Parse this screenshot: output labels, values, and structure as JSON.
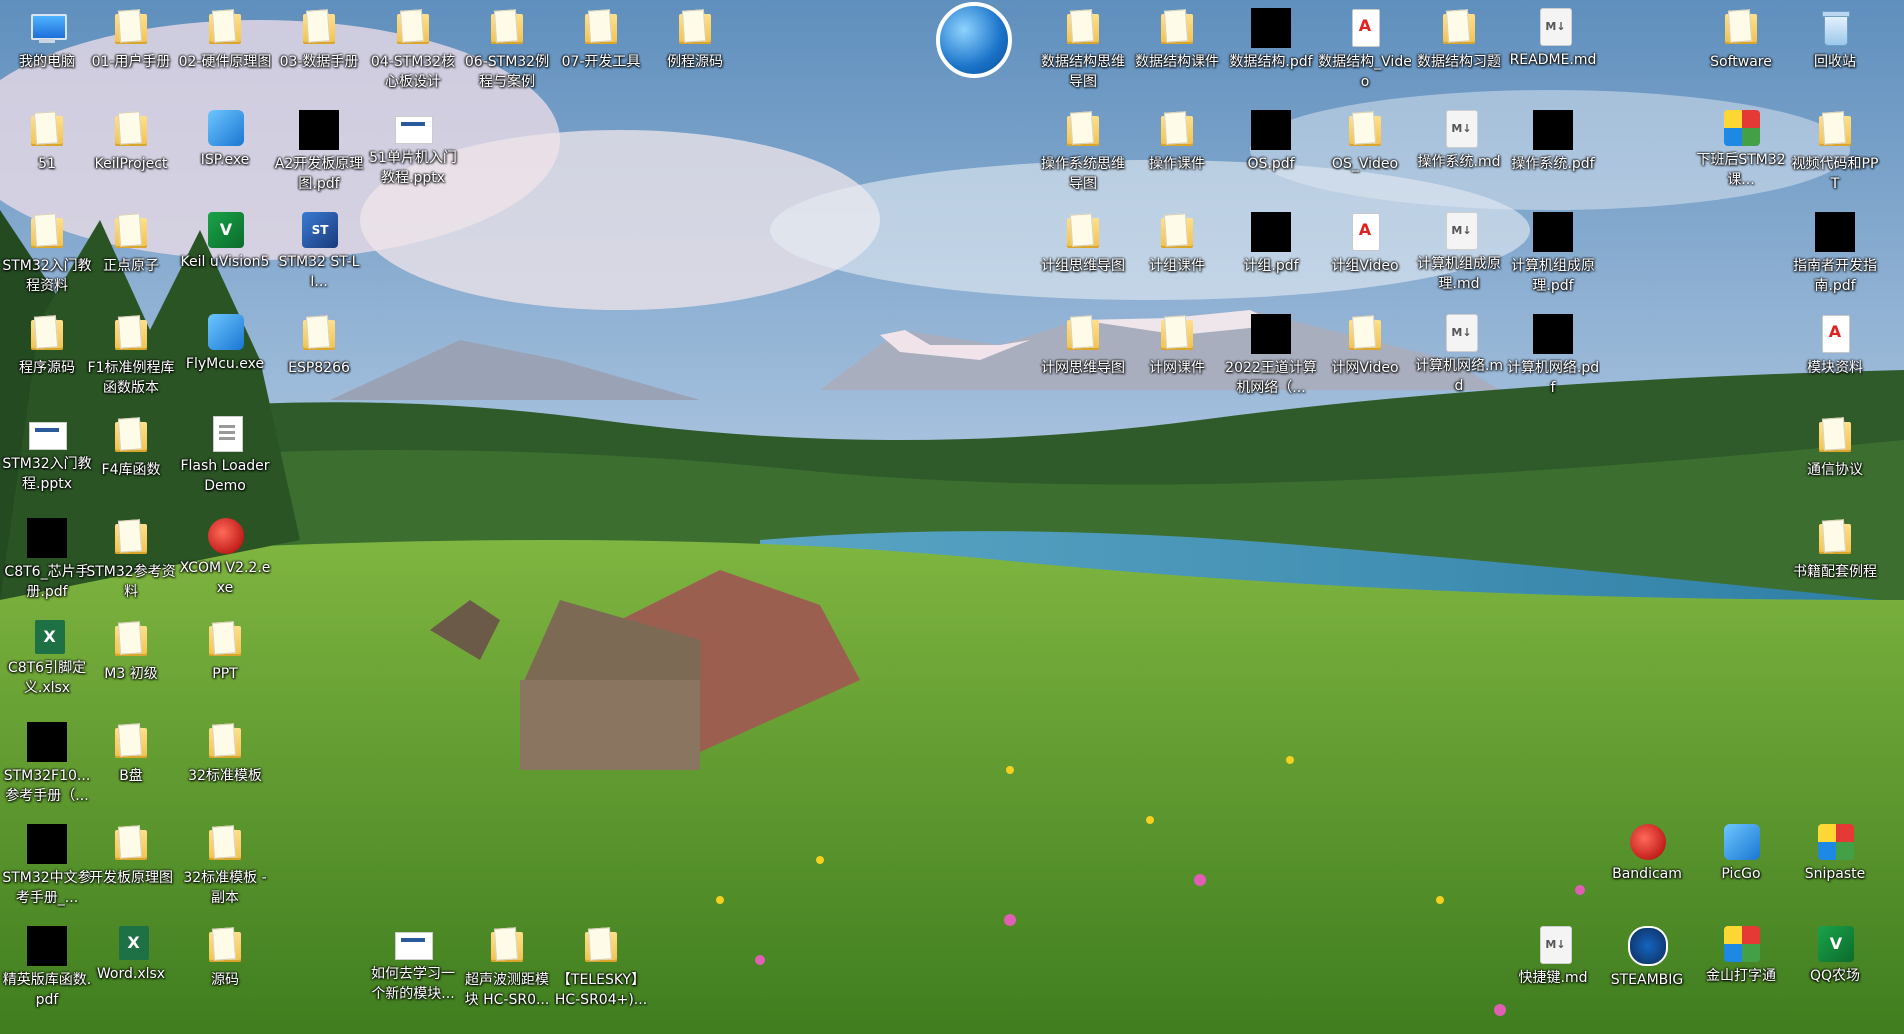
{
  "desktop": {
    "icons": [
      {
        "id": "c1r1",
        "label": "我的电脑",
        "icon": "computer-icon",
        "type": "computer"
      },
      {
        "id": "c2r1",
        "label": "01-用户手册",
        "icon": "folder-icon",
        "type": "folder"
      },
      {
        "id": "c3r1",
        "label": "02-硬件原理图",
        "icon": "folder-icon",
        "type": "folder"
      },
      {
        "id": "c4r1",
        "label": "03-数据手册",
        "icon": "folder-icon",
        "type": "folder"
      },
      {
        "id": "c5r1",
        "label": "04-STM32核心板设计",
        "icon": "folder-icon",
        "type": "folder"
      },
      {
        "id": "c6r1",
        "label": "06-STM32例程与案例",
        "icon": "folder-icon",
        "type": "folder"
      },
      {
        "id": "c7r1",
        "label": "07-开发工具",
        "icon": "folder-icon",
        "type": "folder"
      },
      {
        "id": "c8r1",
        "label": "例程源码",
        "icon": "folder-icon",
        "type": "folder"
      },
      {
        "id": "c1r2",
        "label": "51",
        "icon": "folder-icon",
        "type": "folder"
      },
      {
        "id": "c2r2",
        "label": "KeilProject",
        "icon": "folder-icon",
        "type": "folder"
      },
      {
        "id": "c3r2",
        "label": "ISP.exe",
        "icon": "isp-icon",
        "type": "app4"
      },
      {
        "id": "c4r2",
        "label": "A2开发板原理图.pdf",
        "icon": "black-thumbnail-icon",
        "type": "black"
      },
      {
        "id": "c5r2",
        "label": "51单片机入门教程.pptx",
        "icon": "pptx-icon",
        "type": "pptx"
      },
      {
        "id": "c1r3",
        "label": "STM32入门教程资料",
        "icon": "folder-icon",
        "type": "folder"
      },
      {
        "id": "c2r3",
        "label": "正点原子",
        "icon": "folder-icon",
        "type": "folder"
      },
      {
        "id": "c3r3",
        "label": "Keil uVision5",
        "icon": "keil-icon",
        "type": "app1"
      },
      {
        "id": "c4r3",
        "label": "STM32 ST-LI...",
        "icon": "stlink-icon",
        "type": "app2"
      },
      {
        "id": "c1r4",
        "label": "程序源码",
        "icon": "folder-icon",
        "type": "folder"
      },
      {
        "id": "c2r4",
        "label": "F1标准例程库函数版本",
        "icon": "folder-icon",
        "type": "folder"
      },
      {
        "id": "c3r4",
        "label": "FlyMcu.exe",
        "icon": "flymcu-icon",
        "type": "app4"
      },
      {
        "id": "c4r4",
        "label": "ESP8266",
        "icon": "folder-icon",
        "type": "folder"
      },
      {
        "id": "c1r5",
        "label": "STM32入门教程.pptx",
        "icon": "pptx-icon",
        "type": "pptx"
      },
      {
        "id": "c2r5",
        "label": "F4库函数",
        "icon": "folder-icon",
        "type": "folder"
      },
      {
        "id": "c3r5",
        "label": "Flash Loader Demo",
        "icon": "flash-loader-icon",
        "type": "doc"
      },
      {
        "id": "c1r6",
        "label": "C8T6_芯片手册.pdf",
        "icon": "black-thumbnail-icon",
        "type": "black"
      },
      {
        "id": "c2r6",
        "label": "STM32参考资料",
        "icon": "folder-icon",
        "type": "folder"
      },
      {
        "id": "c3r6",
        "label": "XCOM V2.2.exe",
        "icon": "xcom-icon",
        "type": "app3"
      },
      {
        "id": "c1r7",
        "label": "C8T6引脚定义.xlsx",
        "icon": "excel-icon",
        "type": "xlsx"
      },
      {
        "id": "c2r7",
        "label": "M3 初级",
        "icon": "folder-icon",
        "type": "folder"
      },
      {
        "id": "c3r7",
        "label": "PPT",
        "icon": "folder-icon",
        "type": "folder"
      },
      {
        "id": "c1r8",
        "label": "STM32F10...参考手册（...",
        "icon": "black-thumbnail-icon",
        "type": "black"
      },
      {
        "id": "c2r8",
        "label": "B盘",
        "icon": "folder-icon",
        "type": "folder"
      },
      {
        "id": "c3r8",
        "label": "32标准模板",
        "icon": "folder-icon",
        "type": "folder"
      },
      {
        "id": "c1r9",
        "label": "STM32中文参考手册_...",
        "icon": "black-thumbnail-icon",
        "type": "black"
      },
      {
        "id": "c2r9",
        "label": "开发板原理图",
        "icon": "folder-icon",
        "type": "folder"
      },
      {
        "id": "c3r9",
        "label": "32标准模板 - 副本",
        "icon": "folder-icon",
        "type": "folder"
      },
      {
        "id": "c1r10",
        "label": "精英版库函数.pdf",
        "icon": "black-thumbnail-icon",
        "type": "black"
      },
      {
        "id": "c2r10",
        "label": "Word.xlsx",
        "icon": "excel-icon",
        "type": "xlsx"
      },
      {
        "id": "c3r10",
        "label": "源码",
        "icon": "folder-icon",
        "type": "folder"
      },
      {
        "id": "c5r10",
        "label": "如何去学习一个新的模块...",
        "icon": "pptx-icon",
        "type": "pptx"
      },
      {
        "id": "c6r10",
        "label": "超声波测距模块 HC-SR0...",
        "icon": "folder-icon",
        "type": "folder"
      },
      {
        "id": "c7r10",
        "label": "【TELESKY】HC-SR04+)...",
        "icon": "folder-icon",
        "type": "folder"
      },
      {
        "id": "r1c11",
        "label": "数据结构思维导图",
        "icon": "folder-icon",
        "type": "folder"
      },
      {
        "id": "r1c12",
        "label": "数据结构课件",
        "icon": "folder-icon",
        "type": "folder"
      },
      {
        "id": "r1c13",
        "label": "数据结构.pdf",
        "icon": "black-thumbnail-icon",
        "type": "black"
      },
      {
        "id": "r1c14",
        "label": "数据结构_Video",
        "icon": "pdf-icon",
        "type": "pdf"
      },
      {
        "id": "r1c15",
        "label": "数据结构习题",
        "icon": "folder-icon",
        "type": "folder"
      },
      {
        "id": "r1c16",
        "label": "README.md",
        "icon": "markdown-icon",
        "type": "md"
      },
      {
        "id": "r1c18",
        "label": "Software",
        "icon": "folder-icon",
        "type": "folder"
      },
      {
        "id": "r1c19",
        "label": "回收站",
        "icon": "recycle-bin-icon",
        "type": "trash"
      },
      {
        "id": "r2c11",
        "label": "操作系统思维导图",
        "icon": "folder-icon",
        "type": "folder"
      },
      {
        "id": "r2c12",
        "label": "操作课件",
        "icon": "folder-icon",
        "type": "folder"
      },
      {
        "id": "r2c13",
        "label": "OS.pdf",
        "icon": "black-thumbnail-icon",
        "type": "black"
      },
      {
        "id": "r2c14",
        "label": "OS_Video",
        "icon": "folder-icon",
        "type": "folder"
      },
      {
        "id": "r2c15",
        "label": "操作系统.md",
        "icon": "markdown-icon",
        "type": "md"
      },
      {
        "id": "r2c16",
        "label": "操作系统.pdf",
        "icon": "black-thumbnail-icon",
        "type": "black"
      },
      {
        "id": "r2c18",
        "label": "下班后STM32课...",
        "icon": "stm32-course-icon",
        "type": "app5"
      },
      {
        "id": "r2c19",
        "label": "视频代码和PPT",
        "icon": "folder-icon",
        "type": "folder"
      },
      {
        "id": "r3c11",
        "label": "计组思维导图",
        "icon": "folder-icon",
        "type": "folder"
      },
      {
        "id": "r3c12",
        "label": "计组课件",
        "icon": "folder-icon",
        "type": "folder"
      },
      {
        "id": "r3c13",
        "label": "计组.pdf",
        "icon": "black-thumbnail-icon",
        "type": "black"
      },
      {
        "id": "r3c14",
        "label": "计组Video",
        "icon": "pdf-icon",
        "type": "pdf"
      },
      {
        "id": "r3c15",
        "label": "计算机组成原理.md",
        "icon": "markdown-icon",
        "type": "md"
      },
      {
        "id": "r3c16",
        "label": "计算机组成原理.pdf",
        "icon": "black-thumbnail-icon",
        "type": "black"
      },
      {
        "id": "r3c19",
        "label": "指南者开发指南.pdf",
        "icon": "black-thumbnail-icon",
        "type": "black"
      },
      {
        "id": "r4c11",
        "label": "计网思维导图",
        "icon": "folder-icon",
        "type": "folder"
      },
      {
        "id": "r4c12",
        "label": "计网课件",
        "icon": "folder-icon",
        "type": "folder"
      },
      {
        "id": "r4c13",
        "label": "2022王道计算机网络（...",
        "icon": "black-thumbnail-icon",
        "type": "black"
      },
      {
        "id": "r4c14",
        "label": "计网Video",
        "icon": "folder-icon",
        "type": "folder"
      },
      {
        "id": "r4c15",
        "label": "计算机网络.md",
        "icon": "markdown-icon",
        "type": "md"
      },
      {
        "id": "r4c16",
        "label": "计算机网络.pdf",
        "icon": "black-thumbnail-icon",
        "type": "black"
      },
      {
        "id": "r4c19",
        "label": "模块资料",
        "icon": "pdf-icon",
        "type": "pdf"
      },
      {
        "id": "r5c19",
        "label": "通信协议",
        "icon": "folder-icon",
        "type": "folder"
      },
      {
        "id": "r6c19",
        "label": "书籍配套例程",
        "icon": "folder-icon",
        "type": "folder"
      },
      {
        "id": "r9c17",
        "label": "Bandicam",
        "icon": "bandicam-icon",
        "type": "app3"
      },
      {
        "id": "r9c18",
        "label": "PicGo",
        "icon": "picgo-icon",
        "type": "app4"
      },
      {
        "id": "r9c19",
        "label": "Snipaste",
        "icon": "snipaste-icon",
        "type": "app5"
      },
      {
        "id": "r10c16",
        "label": "快捷键.md",
        "icon": "markdown-icon",
        "type": "md"
      },
      {
        "id": "r10c17",
        "label": "STEAMBIG",
        "icon": "steam-icon",
        "type": "app6"
      },
      {
        "id": "r10c18",
        "label": "金山打字通",
        "icon": "typing-icon",
        "type": "app5"
      },
      {
        "id": "r10c19",
        "label": "QQ农场",
        "icon": "qq-farm-icon",
        "type": "app1"
      }
    ]
  }
}
